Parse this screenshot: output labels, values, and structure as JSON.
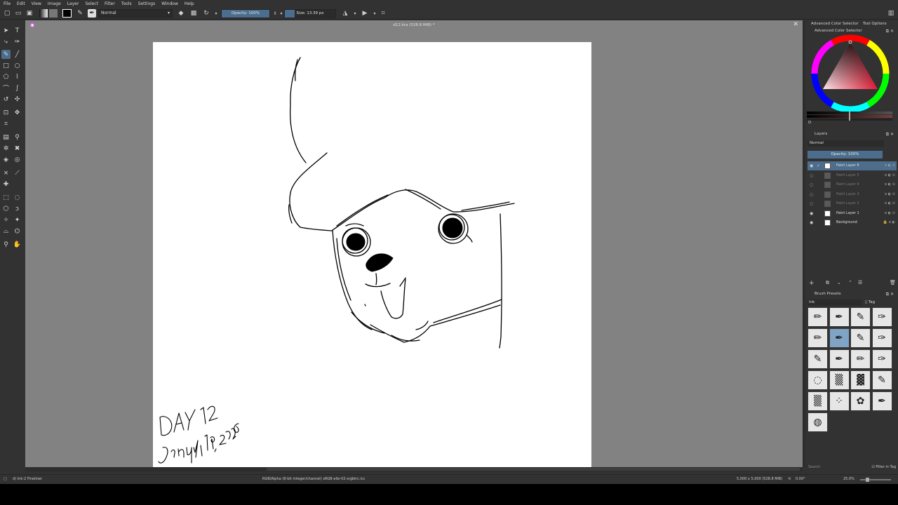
{
  "menu": [
    "File",
    "Edit",
    "View",
    "Image",
    "Layer",
    "Select",
    "Filter",
    "Tools",
    "Settings",
    "Window",
    "Help"
  ],
  "toolbar": {
    "blend_mode": "Normal",
    "opacity_label": "Opacity: 100%",
    "opacity_value": 1.0,
    "size_label": "Size: 13.39 px",
    "size_value": 0.19
  },
  "document": {
    "title": "d12.kra (528.8 MiB) *",
    "signature_line1": "DAY 12",
    "signature_line2": "January 19, 2026"
  },
  "dock": {
    "tab_color": "Advanced Color Selector",
    "tab_tool_options": "Tool Options",
    "color_title": "Advanced Color Selector",
    "layers_title": "Layers",
    "layers_blend": "Normal",
    "layers_opacity": "Opacity: 100%",
    "layers": [
      {
        "name": "Paint Layer 6",
        "visible": true,
        "selected": true,
        "dim": false
      },
      {
        "name": "Paint Layer 5",
        "visible": false,
        "selected": false,
        "dim": true
      },
      {
        "name": "Paint Layer 4",
        "visible": false,
        "selected": false,
        "dim": true
      },
      {
        "name": "Paint Layer 3",
        "visible": false,
        "selected": false,
        "dim": true
      },
      {
        "name": "Paint Layer 2",
        "visible": false,
        "selected": false,
        "dim": true
      },
      {
        "name": "Paint Layer 1",
        "visible": true,
        "selected": false,
        "dim": false
      },
      {
        "name": "Background",
        "visible": true,
        "selected": false,
        "dim": false
      }
    ],
    "brush_title": "Brush Presets",
    "brush_tag": "Ink",
    "brush_tag_button": "Tag",
    "search_placeholder": "Search",
    "filter_label": "Filter in Tag"
  },
  "status": {
    "brush": "d) Ink-2 Fineliner",
    "color_space": "RGB/Alpha (8-bit integer/channel)  sRGB-elle-V2-srgbtrc.icc",
    "dimensions": "5,000 x 5,000 (528.8 MiB)",
    "rotation": "0.00°",
    "zoom": "25.0%"
  },
  "colors": {
    "accent": "#4c6d8c",
    "panel": "#323232",
    "canvas_bg": "#828282"
  }
}
